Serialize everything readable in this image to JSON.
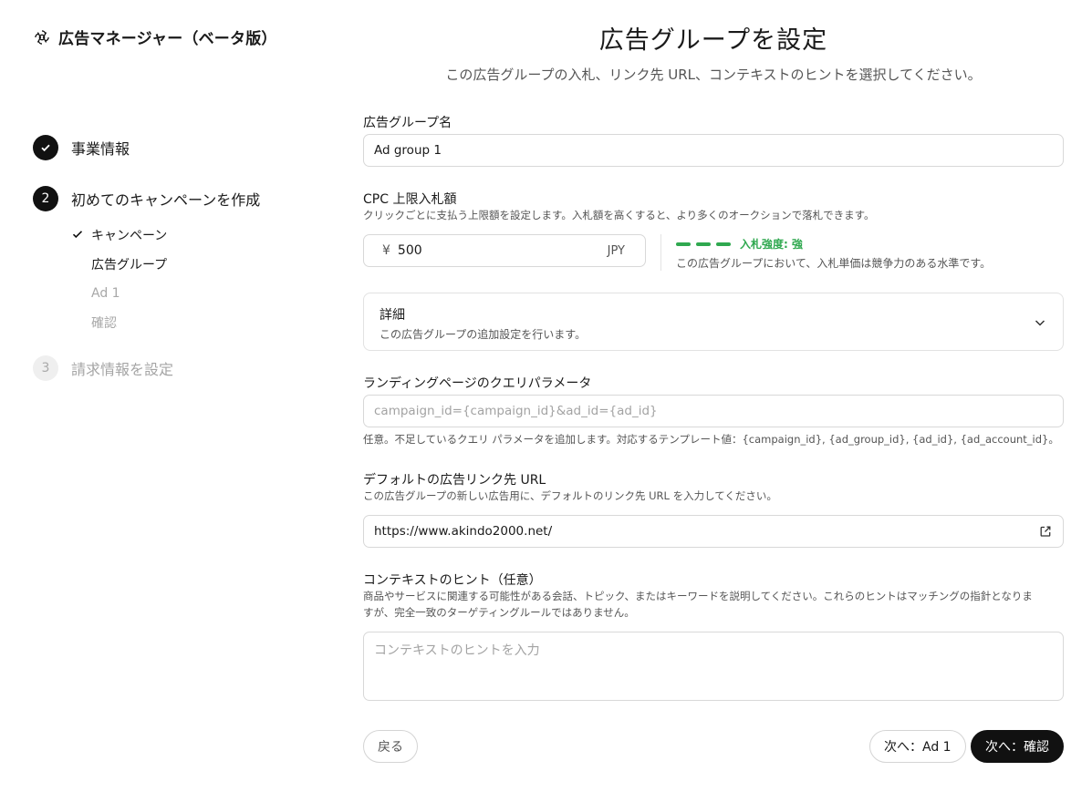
{
  "app": {
    "title": "広告マネージャー（ベータ版）",
    "logo": "openai-logo-icon"
  },
  "steps": [
    {
      "number": "",
      "label": "事業情報",
      "state": "done"
    },
    {
      "number": "2",
      "label": "初めてのキャンペーンを作成",
      "state": "active",
      "substeps": [
        {
          "label": "キャンペーン",
          "state": "done"
        },
        {
          "label": "広告グループ",
          "state": "current"
        },
        {
          "label": "Ad 1",
          "state": "future"
        },
        {
          "label": "確認",
          "state": "future"
        }
      ]
    },
    {
      "number": "3",
      "label": "請求情報を設定",
      "state": "future"
    }
  ],
  "header": {
    "title": "広告グループを設定",
    "subtitle": "この広告グループの入札、リンク先 URL、コンテキストのヒントを選択してください。"
  },
  "ad_group_name": {
    "label": "広告グループ名",
    "value": "Ad group 1"
  },
  "cpc": {
    "label": "CPC 上限入札額",
    "help": "クリックごとに支払う上限額を設定します。入札額を高くすると、より多くのオークションで落札できます。",
    "currency_symbol": "¥",
    "value": "500",
    "currency": "JPY",
    "strength_label": "入札強度: 強",
    "strength_level": 3,
    "strength_color": "#2fa84f",
    "strength_desc": "この広告グループにおいて、入札単価は競争力のある水準です。"
  },
  "details": {
    "title": "詳細",
    "subtitle": "この広告グループの追加設定を行います。",
    "icon": "chevron-down-icon"
  },
  "query_params": {
    "label": "ランディングページのクエリパラメータ",
    "placeholder": "campaign_id={campaign_id}&ad_id={ad_id}",
    "help": "任意。不足しているクエリ パラメータを追加します。対応するテンプレート値：{campaign_id}, {ad_group_id}, {ad_id}, {ad_account_id}。"
  },
  "default_url": {
    "label": "デフォルトの広告リンク先 URL",
    "help": "この広告グループの新しい広告用に、デフォルトのリンク先 URL を入力してください。",
    "value": "https://www.akindo2000.net/",
    "icon": "external-link-icon"
  },
  "context_hints": {
    "label": "コンテキストのヒント（任意）",
    "help_line1": "商品やサービスに関連する可能性がある会話、トピック、またはキーワードを説明してください。これらのヒントはマッチングの指針となりま",
    "help_line2": "すが、完全一致のターゲティングルールではありません。",
    "placeholder": "コンテキストのヒントを入力"
  },
  "buttons": {
    "back": "戻る",
    "next_ad": "次へ：Ad 1",
    "next_confirm": "次へ：確認"
  }
}
